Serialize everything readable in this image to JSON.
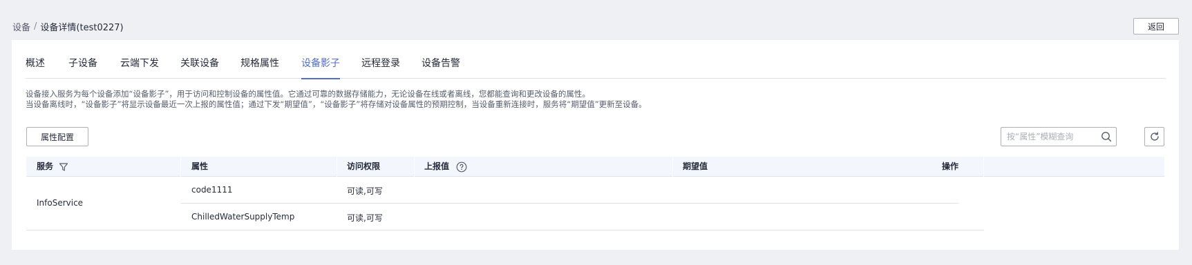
{
  "breadcrumb": {
    "parent": "设备",
    "separator": "/",
    "current": "设备详情(test0227)"
  },
  "header": {
    "back_label": "返回"
  },
  "tabs": [
    {
      "label": "概述"
    },
    {
      "label": "子设备"
    },
    {
      "label": "云端下发"
    },
    {
      "label": "关联设备"
    },
    {
      "label": "规格属性"
    },
    {
      "label": "设备影子"
    },
    {
      "label": "远程登录"
    },
    {
      "label": "设备告警"
    }
  ],
  "active_tab": "设备影子",
  "description": {
    "line1": "设备接入服务为每个设备添加“设备影子”，用于访问和控制设备的属性值。它通过可靠的数据存储能力，无论设备在线或者离线，您都能查询和更改设备的属性。",
    "line2": "当设备离线时，“设备影子”将显示设备最近一次上报的属性值；通过下发“期望值”，“设备影子”将存储对设备属性的预期控制，当设备重新连接时，服务将“期望值”更新至设备。"
  },
  "toolbar": {
    "config_label": "属性配置",
    "search_placeholder": "按“属性”模糊查询"
  },
  "table": {
    "headers": {
      "service": "服务",
      "property": "属性",
      "access": "访问权限",
      "reported": "上报值",
      "desired": "期望值",
      "actions": "操作"
    },
    "service_name": "InfoService",
    "rows": [
      {
        "property": "code1111",
        "access": "可读,可写",
        "reported": "",
        "desired": ""
      },
      {
        "property": "ChilledWaterSupplyTemp",
        "access": "可读,可写",
        "reported": "",
        "desired": ""
      }
    ]
  },
  "colors": {
    "accent": "#526ecc",
    "header_bg": "#f3f6fc",
    "page_bg": "#eff0f4"
  }
}
